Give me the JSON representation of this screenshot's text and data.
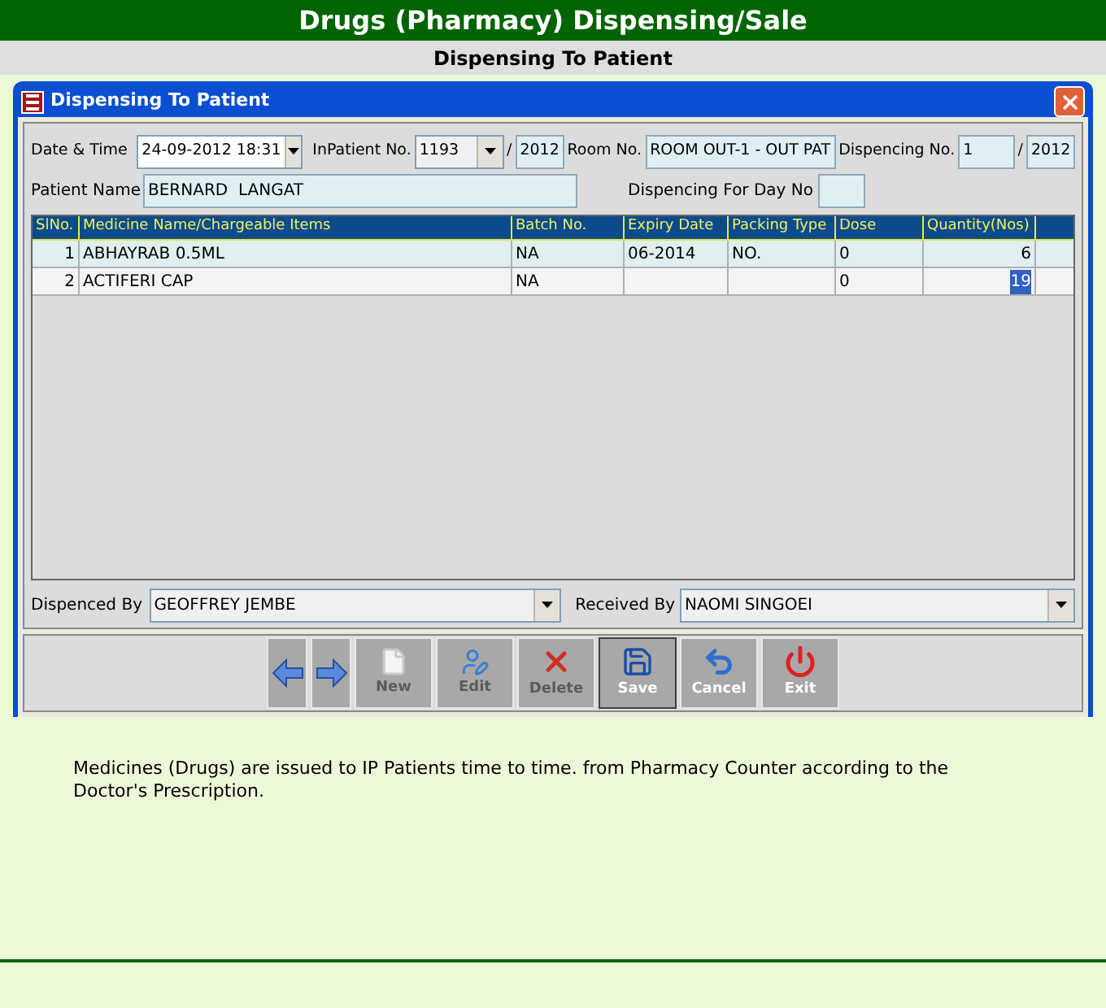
{
  "header": {
    "title": "Drugs (Pharmacy) Dispensing/Sale",
    "subtitle": "Dispensing To Patient"
  },
  "window": {
    "title": "Dispensing To Patient"
  },
  "form": {
    "date_time": {
      "label": "Date & Time",
      "value": "24-09-2012 18:31"
    },
    "inpatient_no": {
      "label": "InPatient No.",
      "value": "1193",
      "separator": "/",
      "year": "2012"
    },
    "room_no": {
      "label": "Room No.",
      "value": "ROOM OUT-1 - OUT PAT"
    },
    "dispencing_no": {
      "label": "Dispencing No.",
      "value": "1",
      "separator": "/",
      "year": "2012"
    },
    "patient_name": {
      "label": "Patient Name",
      "value": "BERNARD  LANGAT"
    },
    "day_no": {
      "label": "Dispencing For Day No"
    }
  },
  "table": {
    "columns": [
      "SlNo.",
      "Medicine Name/Chargeable Items",
      "Batch No.",
      "Expiry Date",
      "Packing Type",
      "Dose",
      "Quantity(Nos)"
    ],
    "rows": [
      {
        "cells": [
          "1",
          "ABHAYRAB 0.5ML",
          "NA",
          "06-2014",
          "NO.",
          "0",
          "6"
        ],
        "quantity_selected": false
      },
      {
        "cells": [
          "2",
          "ACTIFERI CAP",
          "NA",
          "",
          "",
          "0",
          "19"
        ],
        "quantity_selected": true
      }
    ]
  },
  "dispenced_by": {
    "label": "Dispenced By",
    "value": "GEOFFREY JEMBE"
  },
  "received_by": {
    "label": "Received By",
    "value": "NAOMI SINGOEI"
  },
  "toolbar": [
    {
      "kind": "back"
    },
    {
      "kind": "forward"
    },
    {
      "kind": "new",
      "label": "New",
      "disabled": true
    },
    {
      "kind": "edit",
      "label": "Edit",
      "disabled": true
    },
    {
      "kind": "delete",
      "label": "Delete",
      "disabled": true
    },
    {
      "kind": "save",
      "label": "Save",
      "disabled": false
    },
    {
      "kind": "cancel",
      "label": "Cancel",
      "disabled": false
    },
    {
      "kind": "exit",
      "label": "Exit",
      "disabled": false
    }
  ],
  "description": "Medicines (Drugs) are issued to IP Patients time to time. from Pharmacy Counter according to the Doctor's Prescription."
}
